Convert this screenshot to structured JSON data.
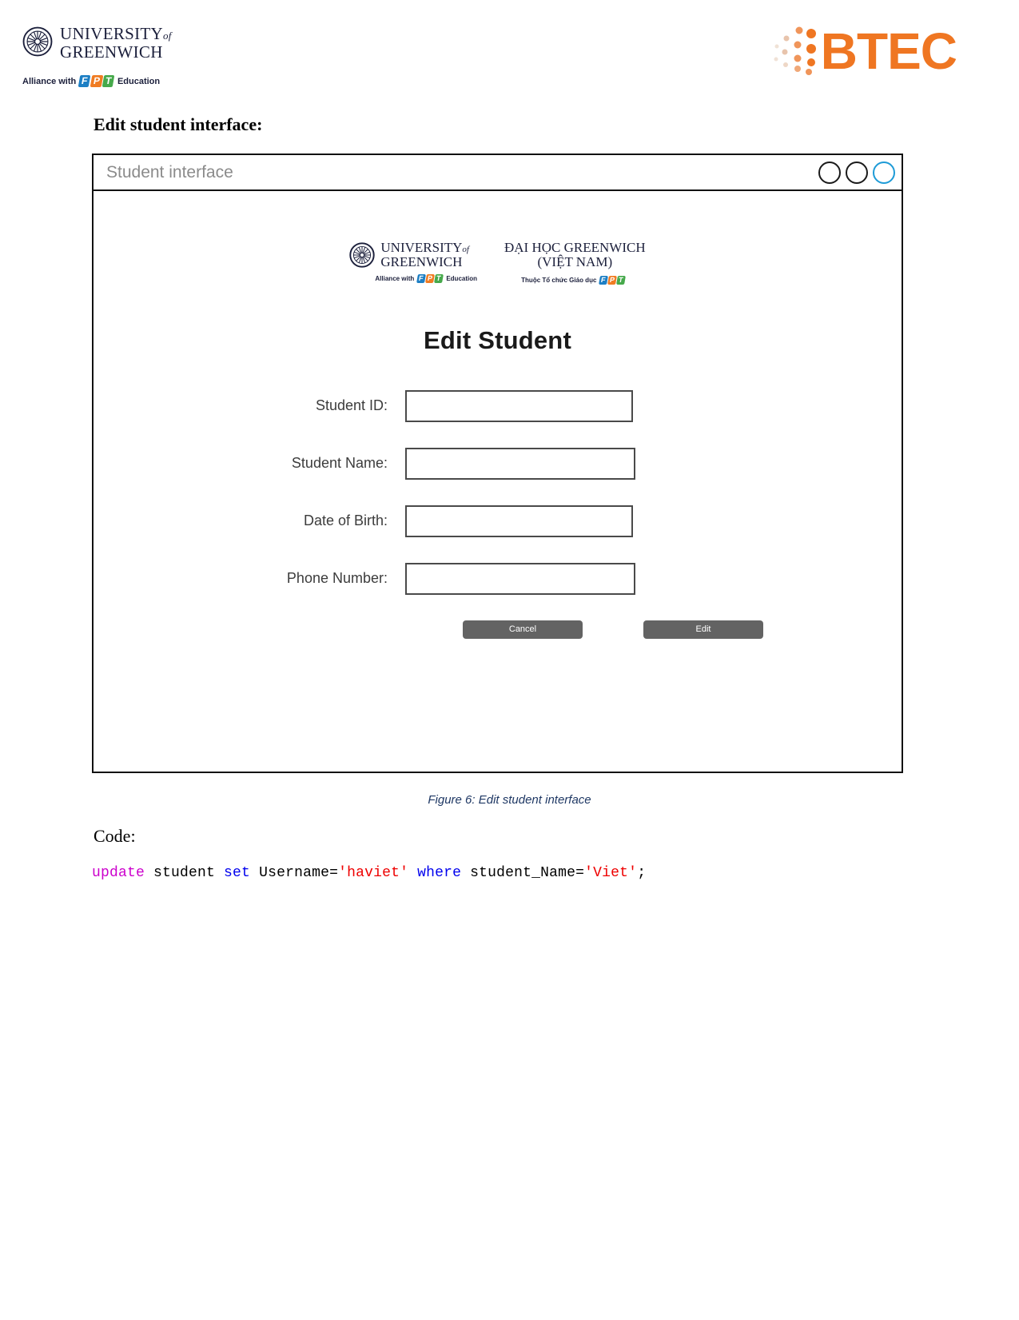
{
  "page_header": {
    "university_logo": {
      "icon": "compass-rose-icon",
      "line1": "UNIVERSITY",
      "of": "of",
      "line2": "GREENWICH",
      "alliance_prefix": "Alliance with",
      "fpt_letters": [
        "F",
        "P",
        "T"
      ],
      "alliance_suffix": "Education"
    },
    "btec_logo": {
      "icon": "btec-dots-icon",
      "word": "BTEC",
      "color": "#ef7622"
    }
  },
  "section": {
    "heading": "Edit student interface:"
  },
  "mockup": {
    "titlebar": {
      "title": "Student interface",
      "controls": [
        {
          "name": "minimize-dot",
          "accent": false
        },
        {
          "name": "maximize-dot",
          "accent": false
        },
        {
          "name": "close-dot",
          "accent": true
        }
      ],
      "accent_color": "#1e9bd7"
    },
    "inner_logos": {
      "uog": {
        "icon": "compass-rose-icon",
        "line1": "UNIVERSITY",
        "of": "of",
        "line2": "GREENWICH",
        "alliance_prefix": "Alliance with",
        "fpt_letters": [
          "F",
          "P",
          "T"
        ],
        "alliance_suffix": "Education"
      },
      "vn": {
        "line1": "ĐẠI HỌC GREENWICH",
        "line2": "(VIỆT NAM)",
        "sub_prefix": "Thuộc Tổ chức Giáo dục",
        "fpt_letters": [
          "F",
          "P",
          "T"
        ]
      }
    },
    "form": {
      "title": "Edit Student",
      "fields": [
        {
          "label": "Student ID:",
          "value": "",
          "placeholder": ""
        },
        {
          "label": "Student Name:",
          "value": "",
          "placeholder": ""
        },
        {
          "label": "Date of Birth:",
          "value": "",
          "placeholder": ""
        },
        {
          "label": "Phone Number:",
          "value": "",
          "placeholder": ""
        }
      ],
      "buttons": {
        "cancel": "Cancel",
        "edit": "Edit"
      },
      "button_color": "#636363"
    }
  },
  "figure": {
    "caption": "Figure 6: Edit student interface",
    "caption_color": "#1f3864"
  },
  "code": {
    "label": "Code:",
    "tokens": [
      {
        "text": "update",
        "type": "keyword-magenta"
      },
      {
        "text": " student ",
        "type": "plain"
      },
      {
        "text": "set",
        "type": "keyword-blue"
      },
      {
        "text": " Username=",
        "type": "plain"
      },
      {
        "text": "'haviet'",
        "type": "string"
      },
      {
        "text": " ",
        "type": "plain"
      },
      {
        "text": "where",
        "type": "keyword-blue"
      },
      {
        "text": " student_Name=",
        "type": "plain"
      },
      {
        "text": "'Viet'",
        "type": "string"
      },
      {
        "text": ";",
        "type": "plain"
      }
    ],
    "full_text": "update student set Username='haviet' where student_Name='Viet';"
  }
}
